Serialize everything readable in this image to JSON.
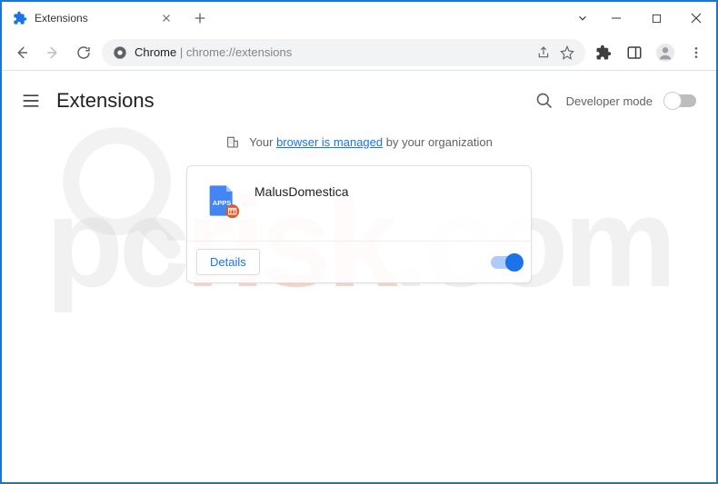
{
  "tab": {
    "title": "Extensions"
  },
  "omnibox": {
    "prefix": "Chrome",
    "separator": " | ",
    "url": "chrome://extensions"
  },
  "header": {
    "title": "Extensions",
    "developer_mode_label": "Developer mode"
  },
  "managed_banner": {
    "prefix": "Your ",
    "link": "browser is managed",
    "suffix": " by your organization"
  },
  "extension": {
    "name": "MalusDomestica",
    "details_label": "Details",
    "enabled": true
  }
}
